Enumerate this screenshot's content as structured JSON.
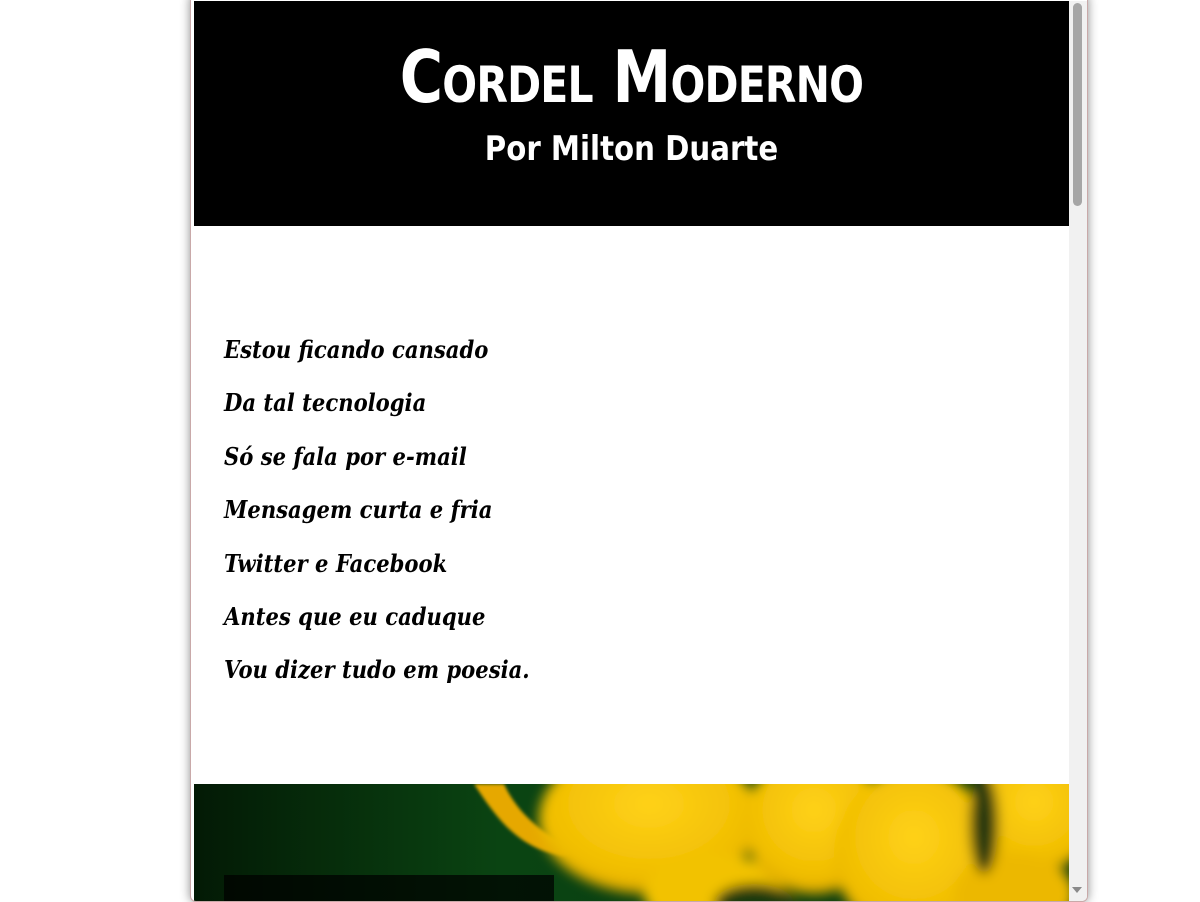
{
  "header": {
    "title": "Cordel Moderno",
    "subtitle": "Por Milton Duarte"
  },
  "poem": {
    "verses": [
      "Estou ficando cansado",
      "Da tal tecnologia",
      "Só se fala por e-mail",
      "Mensagem curta e fria",
      "Twitter e Facebook",
      "Antes que eu caduque",
      "Vou dizer tudo em poesia."
    ]
  },
  "colors": {
    "header_background": "#000000",
    "header_text": "#ffffff",
    "body_text": "#000000",
    "page_background": "#ffffff",
    "image_foliage": "#0d3a10",
    "image_flowers": "#f2c200"
  },
  "icons": {
    "scroll_down": "chevron-down-icon"
  }
}
